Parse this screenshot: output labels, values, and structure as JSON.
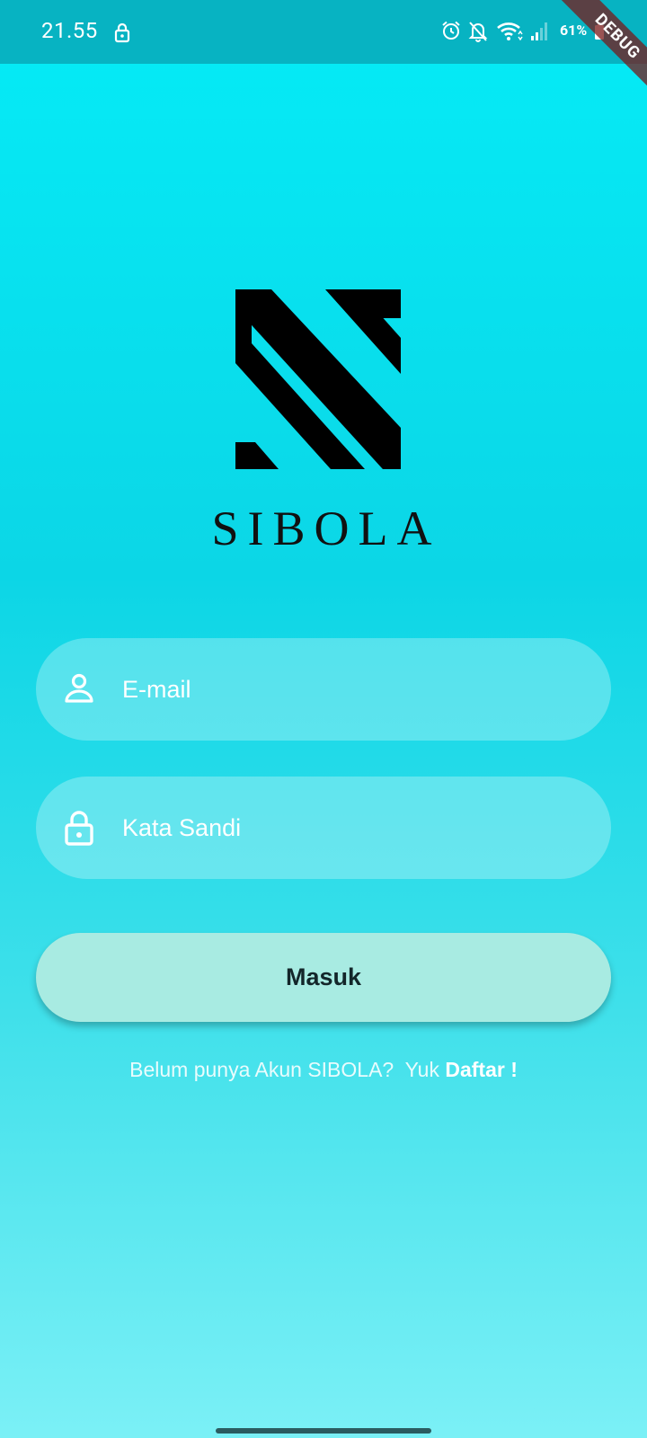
{
  "status_bar": {
    "time": "21.55",
    "battery": "61%",
    "debug_label": "DEBUG",
    "icons": [
      "lock-icon",
      "alarm-icon",
      "bell-off-icon",
      "wifi-icon",
      "signal-icon",
      "battery-icon"
    ]
  },
  "brand": {
    "name": "SIBOLA"
  },
  "login_form": {
    "email_placeholder": "E-mail",
    "email_value": "",
    "password_placeholder": "Kata Sandi",
    "password_value": "",
    "submit_label": "Masuk"
  },
  "register": {
    "prompt": "Belum punya Akun SIBOLA?  Yuk ",
    "link_label": "Daftar !"
  },
  "colors": {
    "status_bar": "#07B3C2",
    "gradient_top": "#04ECF7",
    "gradient_bottom": "#7BF0F6",
    "button": "#A8EBE2",
    "button_text": "#13262A"
  }
}
